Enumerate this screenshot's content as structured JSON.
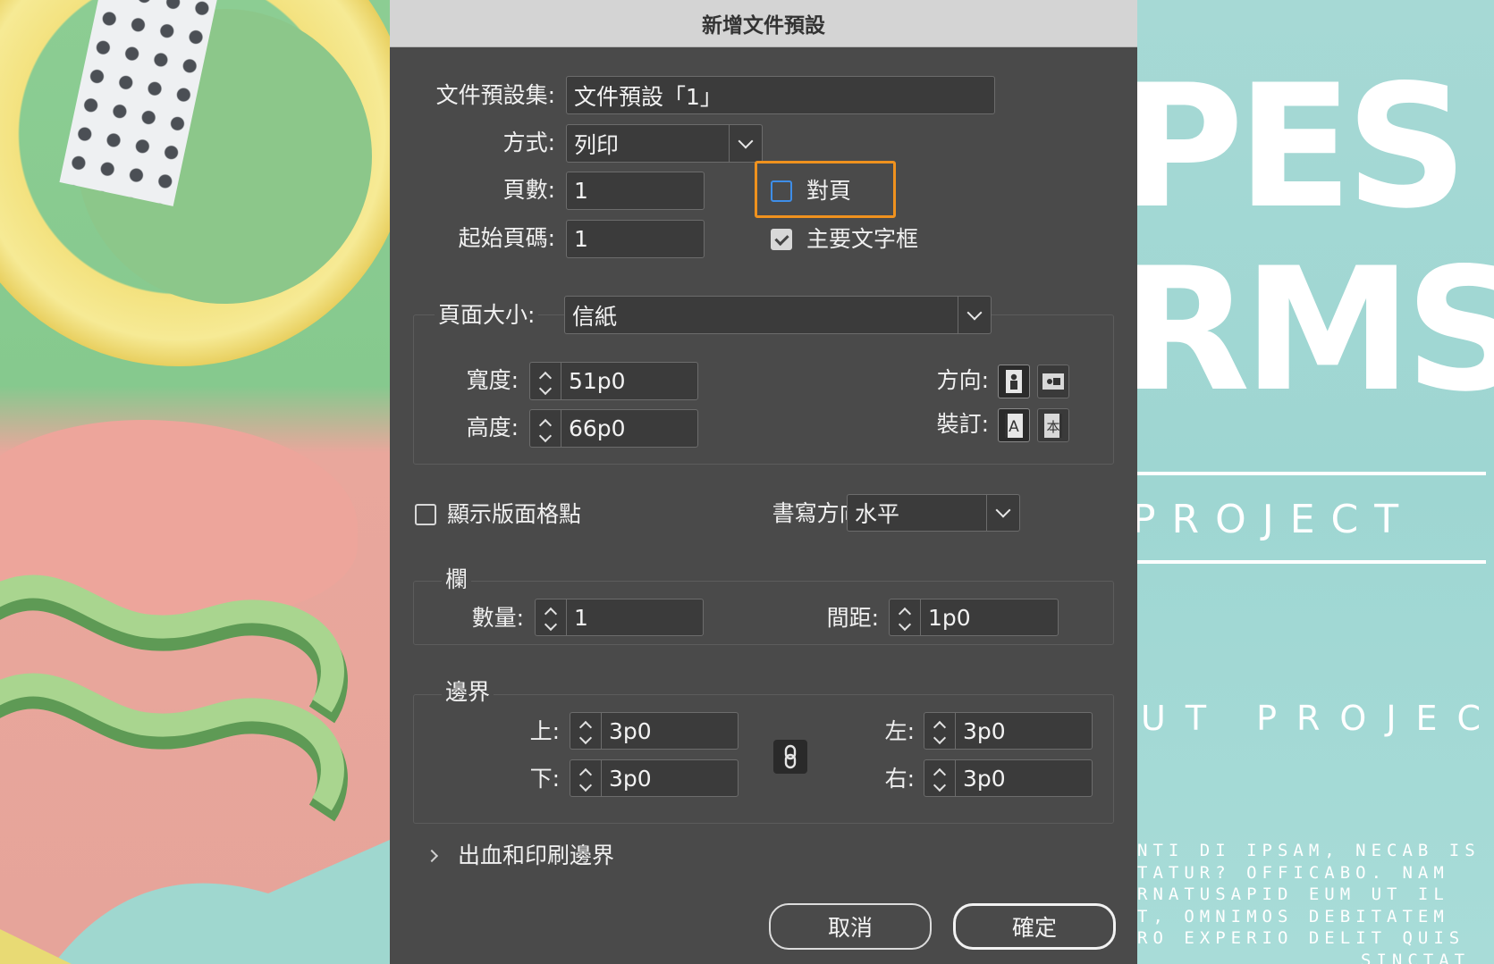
{
  "dialog": {
    "title": "新增文件預設",
    "preset_label": "文件預設集:",
    "preset_value": "文件預設「1」",
    "intent_label": "方式:",
    "intent_value": "列印",
    "pages_label": "頁數:",
    "pages_value": "1",
    "start_page_label": "起始頁碼:",
    "start_page_value": "1",
    "facing_pages_label": "對頁",
    "facing_pages_checked": false,
    "primary_text_frame_label": "主要文字框",
    "primary_text_frame_checked": true,
    "page_size_label": "頁面大小:",
    "page_size_value": "信紙",
    "width_label": "寬度:",
    "width_value": "51p0",
    "height_label": "高度:",
    "height_value": "66p0",
    "orientation_label": "方向:",
    "binding_label": "裝訂:",
    "show_grid_label": "顯示版面格點",
    "show_grid_checked": false,
    "writing_dir_label": "書寫方向:",
    "writing_dir_value": "水平",
    "columns_section": "欄",
    "columns_number_label": "數量:",
    "columns_number_value": "1",
    "columns_gutter_label": "間距:",
    "columns_gutter_value": "1p0",
    "margins_section": "邊界",
    "margin_top_label": "上:",
    "margin_top_value": "3p0",
    "margin_bottom_label": "下:",
    "margin_bottom_value": "3p0",
    "margin_left_label": "左:",
    "margin_left_value": "3p0",
    "margin_right_label": "右:",
    "margin_right_value": "3p0",
    "bleed_label": "出血和印刷邊界",
    "cancel_label": "取消",
    "ok_label": "確定",
    "highlight_color": "#f0921e"
  },
  "background": {
    "word1": "PES",
    "word2": "RMS",
    "line1": "PROJECT",
    "line2": "UT PROJECT",
    "para": [
      "NTI DI IPSAM, NECAB IS",
      "TATUR? OFFICABO. NAM",
      "RNATUSAPID EUM UT IL",
      "T, OMNIMOS DEBITATEM",
      "RO EXPERIO DELIT QUIS",
      "SINCTAT"
    ]
  }
}
